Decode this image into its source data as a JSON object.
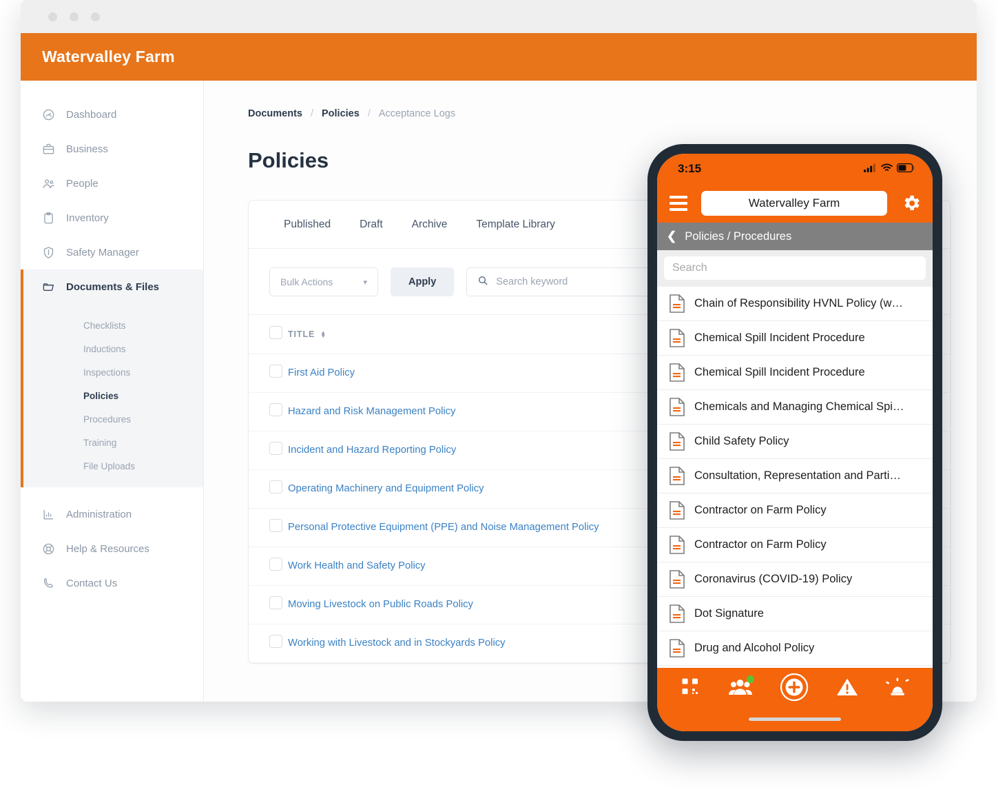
{
  "brand": {
    "orange": "#E8751A",
    "mobile_orange": "#F4650C",
    "link_blue": "#3b82c4"
  },
  "desktop": {
    "header": {
      "org_name": "Watervalley Farm"
    },
    "sidebar": {
      "items": [
        {
          "label": "Dashboard",
          "icon": "dashboard-icon"
        },
        {
          "label": "Business",
          "icon": "briefcase-icon"
        },
        {
          "label": "People",
          "icon": "people-icon"
        },
        {
          "label": "Inventory",
          "icon": "clipboard-icon"
        },
        {
          "label": "Safety Manager",
          "icon": "shield-icon"
        }
      ],
      "active_group": {
        "label": "Documents & Files",
        "icon": "folder-icon"
      },
      "sub_items": [
        {
          "label": "Checklists",
          "active": false
        },
        {
          "label": "Inductions",
          "active": false
        },
        {
          "label": "Inspections",
          "active": false
        },
        {
          "label": "Policies",
          "active": true
        },
        {
          "label": "Procedures",
          "active": false
        },
        {
          "label": "Training",
          "active": false
        },
        {
          "label": "File Uploads",
          "active": false
        }
      ],
      "bottom_items": [
        {
          "label": "Administration",
          "icon": "chart-bar-icon"
        },
        {
          "label": "Help & Resources",
          "icon": "lifebuoy-icon"
        },
        {
          "label": "Contact Us",
          "icon": "phone-icon"
        }
      ]
    },
    "breadcrumb": [
      {
        "label": "Documents",
        "muted": false
      },
      {
        "label": "Policies",
        "muted": false
      },
      {
        "label": "Acceptance Logs",
        "muted": true
      }
    ],
    "breadcrumb_separator": "/",
    "page_title": "Policies",
    "tabs": [
      {
        "label": "Published"
      },
      {
        "label": "Draft"
      },
      {
        "label": "Archive"
      },
      {
        "label": "Template Library"
      }
    ],
    "toolbar": {
      "bulk_actions_label": "Bulk Actions",
      "apply_label": "Apply",
      "search_placeholder": "Search keyword",
      "search_value": ""
    },
    "table": {
      "column_title": "TITLE",
      "rows": [
        {
          "title": "First Aid Policy"
        },
        {
          "title": "Hazard and Risk Management Policy"
        },
        {
          "title": "Incident and Hazard Reporting Policy"
        },
        {
          "title": "Operating Machinery and Equipment Policy"
        },
        {
          "title": "Personal Protective Equipment (PPE) and Noise Management Policy"
        },
        {
          "title": "Work Health and Safety Policy"
        },
        {
          "title": "Moving Livestock on Public Roads Policy"
        },
        {
          "title": "Working with Livestock and in Stockyards Policy"
        }
      ]
    }
  },
  "mobile": {
    "status": {
      "time": "3:15"
    },
    "header": {
      "org_name": "Watervalley Farm"
    },
    "subbar": {
      "title": "Policies / Procedures"
    },
    "search": {
      "placeholder": "Search",
      "value": ""
    },
    "documents": [
      {
        "title": "Chain of Responsibility HVNL Policy (w…"
      },
      {
        "title": "Chemical Spill Incident Procedure"
      },
      {
        "title": "Chemical Spill Incident Procedure"
      },
      {
        "title": "Chemicals and Managing Chemical Spi…"
      },
      {
        "title": "Child Safety Policy"
      },
      {
        "title": "Consultation, Representation and Parti…"
      },
      {
        "title": "Contractor on Farm Policy"
      },
      {
        "title": "Contractor on Farm Policy"
      },
      {
        "title": "Coronavirus (COVID-19) Policy"
      },
      {
        "title": "Dot Signature"
      },
      {
        "title": "Drug and Alcohol Policy"
      }
    ],
    "tabbar": [
      {
        "icon": "qr-code-icon",
        "badge": false
      },
      {
        "icon": "people-group-icon",
        "badge": true
      },
      {
        "icon": "plus-circle-icon",
        "badge": false
      },
      {
        "icon": "warning-triangle-icon",
        "badge": false
      },
      {
        "icon": "siren-alarm-icon",
        "badge": false
      }
    ]
  }
}
